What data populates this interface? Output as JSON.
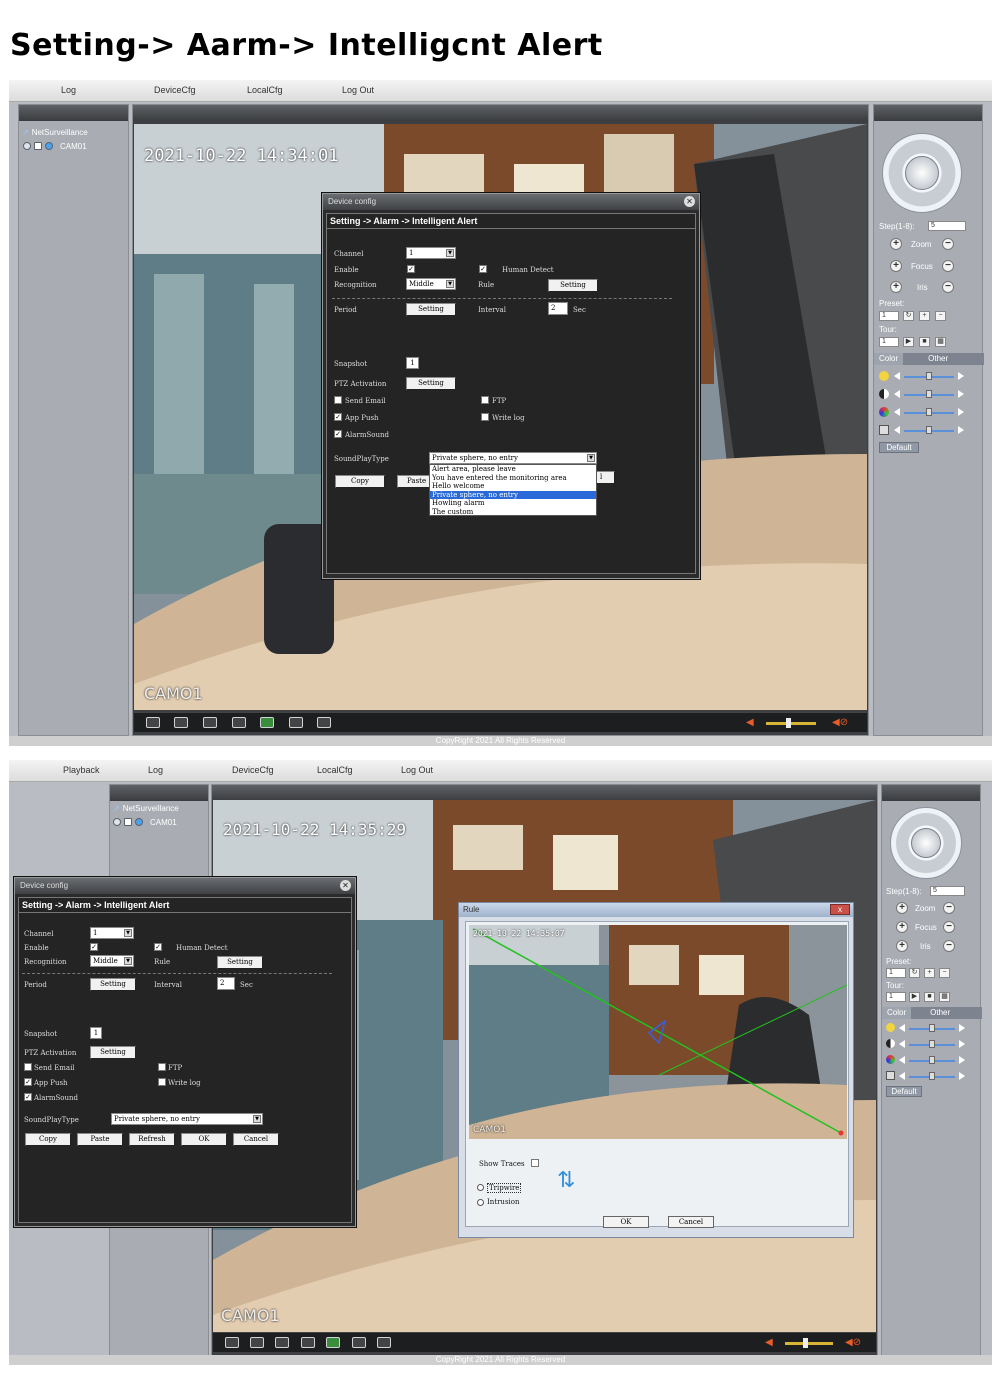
{
  "heading": "Setting-> Aarm-> Intelligcnt Alert",
  "top": {
    "menu": [
      "Log",
      "DeviceCfg",
      "LocalCfg",
      "Log Out"
    ],
    "tree_root": "NetSurveillance",
    "tree_cam": "CAM01",
    "timestamp": "2021-10-22 14:34:01",
    "cam_label": "CAMO1",
    "copyright": "CopyRight 2021 All Rights Reserved"
  },
  "bottom": {
    "menu": [
      "Playback",
      "Log",
      "DeviceCfg",
      "LocalCfg",
      "Log Out"
    ],
    "tree_root": "NetSurveillance",
    "tree_cam": "CAM01",
    "timestamp": "2021-10-22 14:35:29",
    "cam_label": "CAMO1",
    "copyright": "CopyRight 2021 All Rights Reserved"
  },
  "dialog": {
    "title": "Device config",
    "subtitle": "Setting -> Alarm -> Intelligent Alert",
    "channel_label": "Channel",
    "channel_value": "1",
    "enable_label": "Enable",
    "human_detect_label": "Human Detect",
    "recognition_label": "Recognition",
    "recognition_value": "Middle",
    "rule_label": "Rule",
    "setting_label": "Setting",
    "period_label": "Period",
    "interval_label": "Interval",
    "interval_value": "2",
    "sec_label": "Sec",
    "snapshot_label": "Snapshot",
    "snapshot_value": "1",
    "ptz_label": "PTZ Activation",
    "send_email_label": "Send Email",
    "ftp_label": "FTP",
    "app_push_label": "App Push",
    "write_log_label": "Write log",
    "alarm_sound_label": "AlarmSound",
    "sound_type_label": "SoundPlayType",
    "sound_type_value": "Private sphere, no entry",
    "sound_options": [
      "Alert area, please leave",
      "You have entered the monitoring area",
      "Hello welcome",
      "Private sphere, no entry",
      "Howling alarm",
      "The custom"
    ],
    "selected_option_index": 3,
    "buttons": [
      "Copy",
      "Paste",
      "Refresh",
      "OK",
      "Cancel"
    ],
    "top_visible_buttons": [
      "Copy",
      "Paste"
    ],
    "top_hidden_tail": "l"
  },
  "side": {
    "step_label": "Step(1-8):",
    "step_value": "5",
    "zoom_label": "Zoom",
    "focus_label": "Focus",
    "iris_label": "Iris",
    "preset_label": "Preset:",
    "preset_value": "1",
    "tour_label": "Tour:",
    "tour_value": "1",
    "tab_color": "Color",
    "tab_other": "Other",
    "default_label": "Default"
  },
  "rule_window": {
    "title": "Rule",
    "close": "x",
    "timestamp": "2021-10-22 14:35:07",
    "cam_label": "CAMO1",
    "show_traces_label": "Show Traces",
    "tripwire_label": "Tripwire",
    "intrusion_label": "Intrusion",
    "ok_label": "OK",
    "cancel_label": "Cancel"
  },
  "colors": {
    "accent": "#2a6ad8",
    "panel": "#a9acb3",
    "dialog_bg": "#2b2b2b",
    "tripwire": "#22c11e"
  }
}
